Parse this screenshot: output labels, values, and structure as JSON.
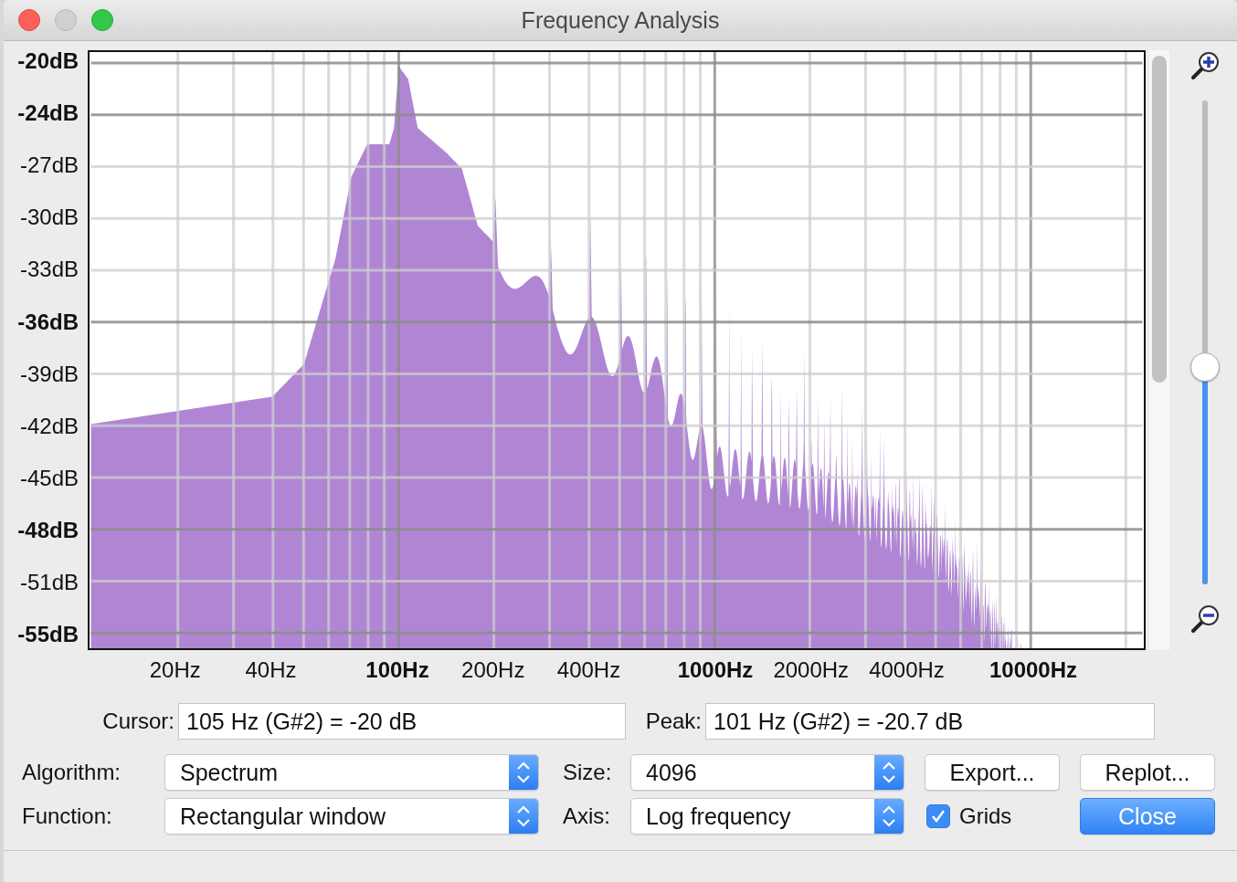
{
  "window": {
    "title": "Frequency Analysis"
  },
  "plot": {
    "y_ticks": [
      {
        "label": "-20dB",
        "major": true
      },
      {
        "label": "-24dB",
        "major": true
      },
      {
        "label": "-27dB",
        "major": false
      },
      {
        "label": "-30dB",
        "major": false
      },
      {
        "label": "-33dB",
        "major": false
      },
      {
        "label": "-36dB",
        "major": true
      },
      {
        "label": "-39dB",
        "major": false
      },
      {
        "label": "-42dB",
        "major": false
      },
      {
        "label": "-45dB",
        "major": false
      },
      {
        "label": "-48dB",
        "major": true
      },
      {
        "label": "-51dB",
        "major": false
      },
      {
        "label": "-55dB",
        "major": true
      }
    ],
    "x_ticks": [
      {
        "label": "20Hz",
        "major": false
      },
      {
        "label": "40Hz",
        "major": false
      },
      {
        "label": "100Hz",
        "major": true
      },
      {
        "label": "200Hz",
        "major": false
      },
      {
        "label": "400Hz",
        "major": false
      },
      {
        "label": "1000Hz",
        "major": true
      },
      {
        "label": "2000Hz",
        "major": false
      },
      {
        "label": "4000Hz",
        "major": false
      },
      {
        "label": "10000Hz",
        "major": true
      }
    ]
  },
  "zoom_slider": {
    "level": 0.45
  },
  "cursor": {
    "label": "Cursor:",
    "value": "105 Hz (G#2) = -20 dB"
  },
  "peak": {
    "label": "Peak:",
    "value": "101 Hz (G#2) = -20.7 dB"
  },
  "algorithm": {
    "label": "Algorithm:",
    "value": "Spectrum"
  },
  "size": {
    "label": "Size:",
    "value": "4096"
  },
  "function": {
    "label": "Function:",
    "value": "Rectangular window"
  },
  "axis": {
    "label": "Axis:",
    "value": "Log frequency"
  },
  "grids": {
    "label": "Grids",
    "checked": true
  },
  "buttons": [
    {
      "label": "Export...",
      "primary": false
    },
    {
      "label": "Replot...",
      "primary": false
    },
    {
      "label": "Close",
      "primary": true
    }
  ]
}
